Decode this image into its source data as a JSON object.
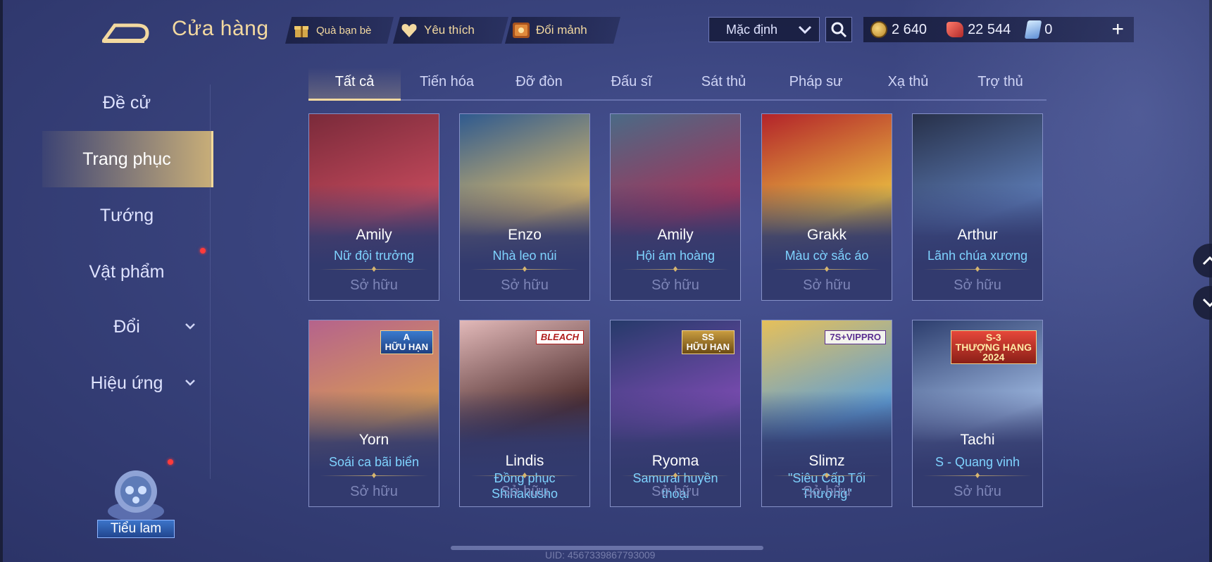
{
  "header": {
    "title": "Cửa hàng",
    "buttons": [
      {
        "label": "Quà bạn bè",
        "icon": "gift-icon"
      },
      {
        "label": "Yêu thích",
        "icon": "heart-icon"
      },
      {
        "label": "Đổi mảnh",
        "icon": "shard-chest-icon"
      }
    ],
    "sort": {
      "selected": "Mặc định"
    },
    "currency": {
      "gold": "2 640",
      "ruby": "22 544",
      "vouchers": "0"
    },
    "add": "+"
  },
  "sidebar": {
    "items": [
      {
        "label": "Đề cử"
      },
      {
        "label": "Trang phục",
        "active": true
      },
      {
        "label": "Tướng"
      },
      {
        "label": "Vật phẩm",
        "notify": true
      },
      {
        "label": "Đổi",
        "expandable": true
      },
      {
        "label": "Hiệu ứng",
        "expandable": true
      }
    ],
    "pet": {
      "label": "Tiểu lam",
      "notify": true
    }
  },
  "tabs": [
    "Tất cả",
    "Tiến hóa",
    "Đỡ đòn",
    "Đấu sĩ",
    "Sát thủ",
    "Pháp sư",
    "Xạ thủ",
    "Trợ thủ"
  ],
  "active_tab": 0,
  "cards": [
    {
      "hero": "Amily",
      "skin": [
        "Nữ đội trưởng"
      ],
      "status": "Sở hữu",
      "tag": "",
      "colors": [
        "#7a2a3a",
        "#c2495b"
      ]
    },
    {
      "hero": "Enzo",
      "skin": [
        "Nhà leo núi"
      ],
      "status": "Sở hữu",
      "tag": "",
      "colors": [
        "#2f5a8f",
        "#d8b86a"
      ]
    },
    {
      "hero": "Amily",
      "skin": [
        "Hội ám hoàng"
      ],
      "status": "Sở hữu",
      "tag": "",
      "colors": [
        "#4a6a86",
        "#a3345a"
      ]
    },
    {
      "hero": "Grakk",
      "skin": [
        "Màu cờ sắc áo"
      ],
      "status": "Sở hữu",
      "tag": "",
      "colors": [
        "#b3232a",
        "#e8b940"
      ]
    },
    {
      "hero": "Arthur",
      "skin": [
        "Lãnh chúa xương"
      ],
      "status": "Sở hữu",
      "tag": "",
      "colors": [
        "#273049",
        "#5b7ab3"
      ]
    },
    {
      "hero": "Yorn",
      "skin": [
        "Soái ca bãi biển"
      ],
      "status": "Sở hữu",
      "tag": "A\nHỮU HẠN",
      "tagStyle": "",
      "colors": [
        "#b5638c",
        "#d89a55"
      ]
    },
    {
      "hero": "Lindis",
      "skin": [
        "Đồng phục",
        "Shihakusho"
      ],
      "status": "Sở hữu",
      "tag": "BLEACH",
      "tagStyle": "white",
      "colors": [
        "#e2b9b9",
        "#4b2a2a"
      ]
    },
    {
      "hero": "Ryoma",
      "skin": [
        "Samurai huyền",
        "thoại"
      ],
      "status": "Sở hữu",
      "tag": "SS\nHỮU HẠN",
      "tagStyle": "gold",
      "colors": [
        "#263a6a",
        "#7a4bb0"
      ]
    },
    {
      "hero": "Slimz",
      "skin": [
        "\"Siêu Cấp Tối",
        "Thượng\""
      ],
      "status": "Sở hữu",
      "tag": "7S+VIPPRO",
      "tagStyle": "vip",
      "colors": [
        "#e6c05a",
        "#5f9fd6"
      ]
    },
    {
      "hero": "Tachi",
      "skin": [
        "S - Quang vinh"
      ],
      "status": "Sở hữu",
      "tag": "S-3\nTHƯỢNG HẠNG\n2024",
      "tagStyle": "red",
      "colors": [
        "#2d3e6e",
        "#9ab4dd"
      ]
    }
  ],
  "uid": "UID: 4567339867793009"
}
